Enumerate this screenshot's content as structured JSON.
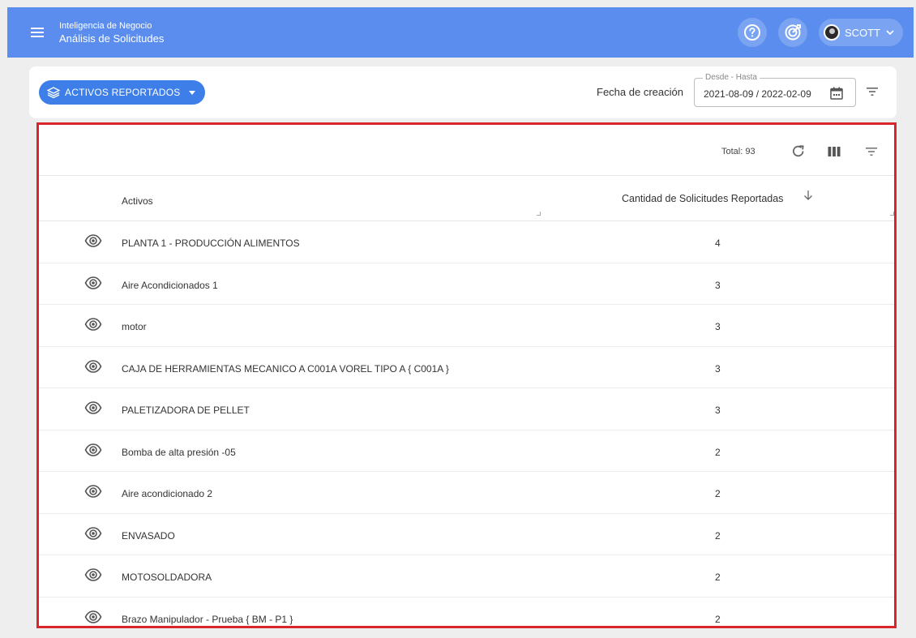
{
  "header": {
    "section": "Inteligencia de Negocio",
    "title": "Análisis de Solicitudes",
    "user": "SCOTT"
  },
  "filters": {
    "assets_button": "ACTIVOS REPORTADOS",
    "fecha_label": "Fecha de creación",
    "date_legend": "Desde - Hasta",
    "date_value": "2021-08-09 / 2022-02-09"
  },
  "table": {
    "total": "Total: 93",
    "columns": [
      "Activos",
      "Cantidad de Solicitudes Reportadas"
    ],
    "rows": [
      {
        "name": "PLANTA 1 - PRODUCCIÓN ALIMENTOS",
        "count": "4"
      },
      {
        "name": "Aire Acondicionados 1",
        "count": "3"
      },
      {
        "name": "motor",
        "count": "3"
      },
      {
        "name": "CAJA DE HERRAMIENTAS MECANICO A C001A VOREL TIPO A { C001A }",
        "count": "3"
      },
      {
        "name": "PALETIZADORA DE PELLET",
        "count": "3"
      },
      {
        "name": "Bomba de alta presión -05",
        "count": "2"
      },
      {
        "name": "Aire acondicionado 2",
        "count": "2"
      },
      {
        "name": "ENVASADO",
        "count": "2"
      },
      {
        "name": "MOTOSOLDADORA",
        "count": "2"
      },
      {
        "name": "Brazo Manipulador - Prueba { BM - P1 }",
        "count": "2"
      }
    ]
  },
  "colors": {
    "appbar": "#5b8def",
    "accent_button": "#3d7ee8",
    "highlight_border": "#d9262c"
  },
  "icons": [
    "menu-icon",
    "help-icon",
    "target-icon",
    "chevron-down-icon",
    "layers-icon",
    "calendar-icon",
    "filter-icon",
    "refresh-icon",
    "columns-icon",
    "sort-down-icon",
    "eye-icon"
  ]
}
